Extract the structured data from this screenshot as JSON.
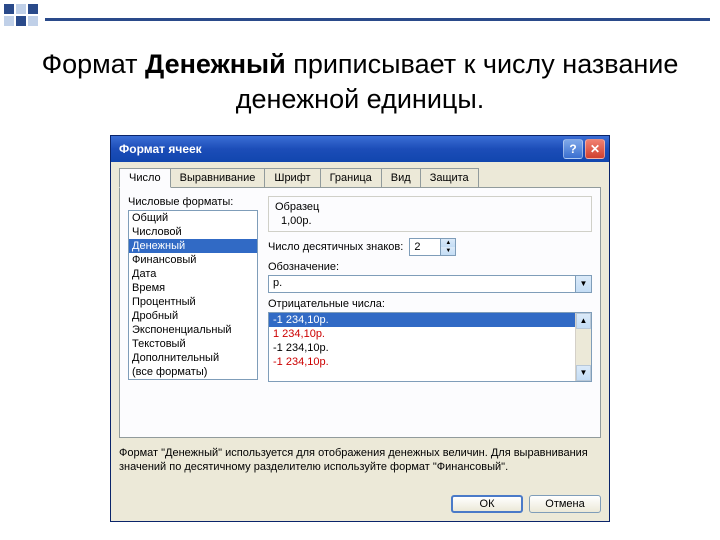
{
  "title": {
    "prefix": "Формат ",
    "bold": "Денежный",
    "suffix": " приписывает к числу название денежной единицы."
  },
  "dialog": {
    "title": "Формат ячеек",
    "tabs": [
      "Число",
      "Выравнивание",
      "Шрифт",
      "Граница",
      "Вид",
      "Защита"
    ],
    "active_tab": 0,
    "formats_label": "Числовые форматы:",
    "formats": [
      "Общий",
      "Числовой",
      "Денежный",
      "Финансовый",
      "Дата",
      "Время",
      "Процентный",
      "Дробный",
      "Экспоненциальный",
      "Текстовый",
      "Дополнительный",
      "(все форматы)"
    ],
    "formats_selected": 2,
    "sample_label": "Образец",
    "sample_value": "1,00р.",
    "decimals_label": "Число десятичных знаков:",
    "decimals_value": "2",
    "symbol_label": "Обозначение:",
    "symbol_value": "р.",
    "negative_label": "Отрицательные числа:",
    "negative_items": [
      {
        "text": "-1 234,10р.",
        "selected": true,
        "red": false
      },
      {
        "text": "1 234,10р.",
        "selected": false,
        "red": true
      },
      {
        "text": "-1 234,10р.",
        "selected": false,
        "red": false
      },
      {
        "text": "-1 234,10р.",
        "selected": false,
        "red": true
      }
    ],
    "description": "Формат \"Денежный\" используется для отображения денежных величин. Для выравнивания значений по десятичному разделителю используйте формат \"Финансовый\".",
    "ok": "ОК",
    "cancel": "Отмена"
  }
}
